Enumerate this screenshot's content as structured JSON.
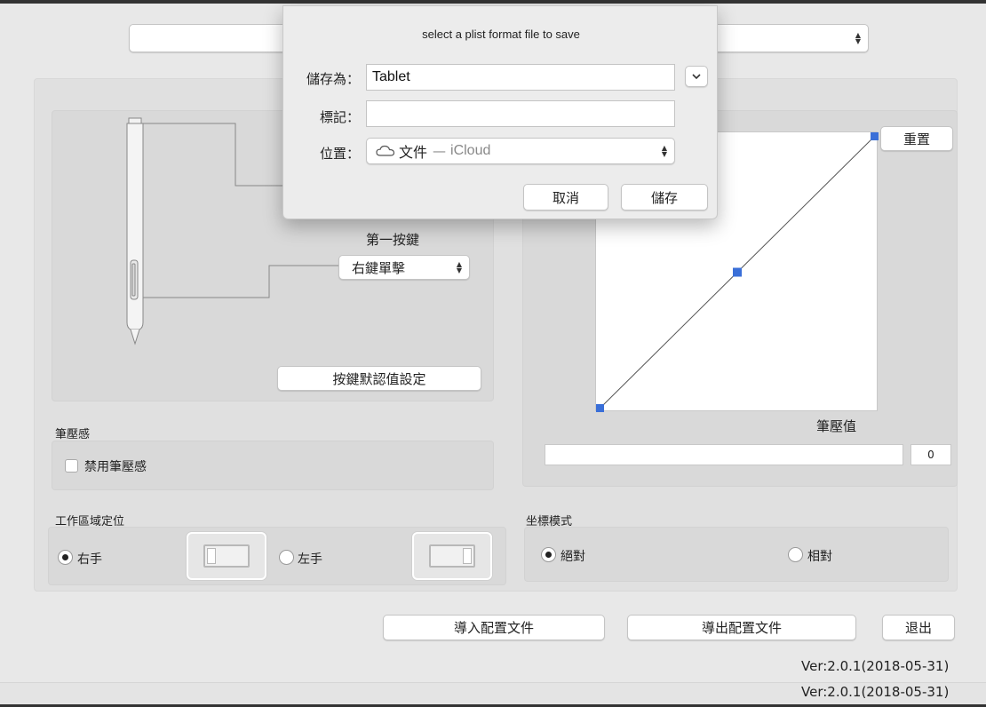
{
  "top_select": {
    "value": ""
  },
  "pen_buttons": {
    "first_button_label": "第一按鍵",
    "first_button_value": "右鍵單擊",
    "default_settings_button": "按鍵默認值設定"
  },
  "pressure": {
    "reset_button": "重置",
    "pressure_value_label": "筆壓值",
    "pressure_value": "0",
    "curve_points": [
      [
        0,
        0
      ],
      [
        0.5,
        0.5
      ],
      [
        1,
        1
      ]
    ]
  },
  "pen_pressure": {
    "section_label": "筆壓感",
    "disable_checkbox_label": "禁用筆壓感",
    "disable_checked": false
  },
  "work_area": {
    "section_label": "工作區域定位",
    "right_hand_label": "右手",
    "left_hand_label": "左手",
    "selected": "right"
  },
  "coordinate_mode": {
    "section_label": "坐標模式",
    "absolute_label": "絕對",
    "relative_label": "相對",
    "selected": "absolute"
  },
  "footer": {
    "import_button": "導入配置文件",
    "export_button": "導出配置文件",
    "quit_button": "退出",
    "version_1": "Ver:2.0.1(2018-05-31)",
    "version_2": "Ver:2.0.1(2018-05-31)"
  },
  "save_dialog": {
    "title": "select a plist format file to save",
    "save_as_label": "儲存為：",
    "save_as_value": "Tablet",
    "tags_label": "標記：",
    "tags_value": "",
    "location_label": "位置：",
    "location_folder": "文件",
    "location_sep": "—",
    "location_service": "iCloud",
    "cancel_button": "取消",
    "save_button": "儲存"
  },
  "colors": {
    "accent": "#3a6fd8",
    "curve_line": "#555555"
  },
  "icons": {
    "select_arrows": "up-down-chevron",
    "expand": "chevron-down",
    "location": "cloud"
  }
}
